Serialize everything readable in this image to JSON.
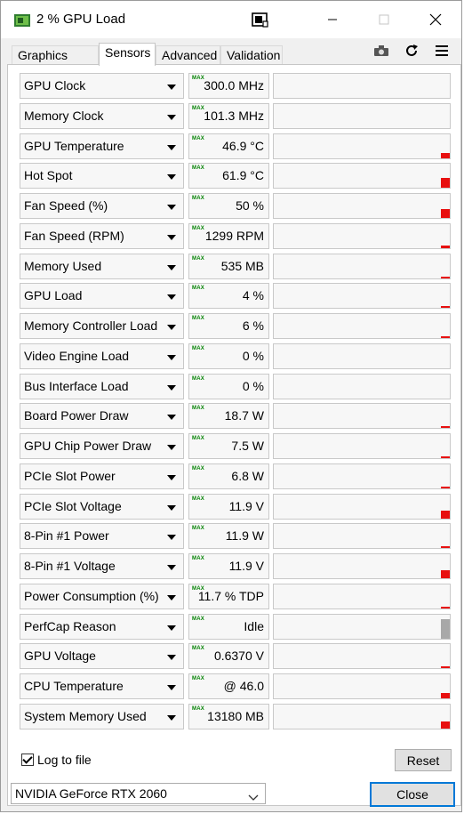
{
  "window": {
    "title": "2 % GPU Load"
  },
  "tabs": [
    {
      "label": "Graphics Card"
    },
    {
      "label": "Sensors"
    },
    {
      "label": "Advanced"
    },
    {
      "label": "Validation"
    }
  ],
  "max_label": "MAX",
  "sensors": [
    {
      "name": "GPU Clock",
      "value": "300.0 MHz",
      "graph_level": 0
    },
    {
      "name": "Memory Clock",
      "value": "101.3 MHz",
      "graph_level": 0
    },
    {
      "name": "GPU Temperature",
      "value": "46.9 °C",
      "graph_level": 0.22
    },
    {
      "name": "Hot Spot",
      "value": "61.9 °C",
      "graph_level": 0.42
    },
    {
      "name": "Fan Speed (%)",
      "value": "50 %",
      "graph_level": 0.38
    },
    {
      "name": "Fan Speed (RPM)",
      "value": "1299 RPM",
      "graph_level": 0.1
    },
    {
      "name": "Memory Used",
      "value": "535 MB",
      "graph_level": 0.08
    },
    {
      "name": "GPU Load",
      "value": "4 %",
      "graph_level": 0.06
    },
    {
      "name": "Memory Controller Load",
      "value": "6 %",
      "graph_level": 0.06
    },
    {
      "name": "Video Engine Load",
      "value": "0 %",
      "graph_level": 0
    },
    {
      "name": "Bus Interface Load",
      "value": "0 %",
      "graph_level": 0
    },
    {
      "name": "Board Power Draw",
      "value": "18.7 W",
      "graph_level": 0.08
    },
    {
      "name": "GPU Chip Power Draw",
      "value": "7.5 W",
      "graph_level": 0.04
    },
    {
      "name": "PCIe Slot Power",
      "value": "6.8 W",
      "graph_level": 0.08
    },
    {
      "name": "PCIe Slot Voltage",
      "value": "11.9 V",
      "graph_level": 0.34
    },
    {
      "name": "8-Pin #1 Power",
      "value": "11.9 W",
      "graph_level": 0.08
    },
    {
      "name": "8-Pin #1 Voltage",
      "value": "11.9 V",
      "graph_level": 0.34
    },
    {
      "name": "Power Consumption (%)",
      "value": "11.7 % TDP",
      "graph_level": 0.08
    },
    {
      "name": "PerfCap Reason",
      "value": "Idle",
      "graph_level": 0.8,
      "graph_color": "gray"
    },
    {
      "name": "GPU Voltage",
      "value": "0.6370 V",
      "graph_level": 0.08
    },
    {
      "name": "CPU Temperature",
      "value": "@ 46.0",
      "graph_level": 0.22
    },
    {
      "name": "System Memory Used",
      "value": "13180 MB",
      "graph_level": 0.3
    }
  ],
  "footer": {
    "log_label": "Log to file",
    "log_checked": true,
    "reset_label": "Reset",
    "gpu_select": "NVIDIA GeForce RTX 2060",
    "close_label": "Close"
  },
  "colors": {
    "graph_bar": "#e81010",
    "max_text": "#008000",
    "accent": "#0078d7"
  }
}
